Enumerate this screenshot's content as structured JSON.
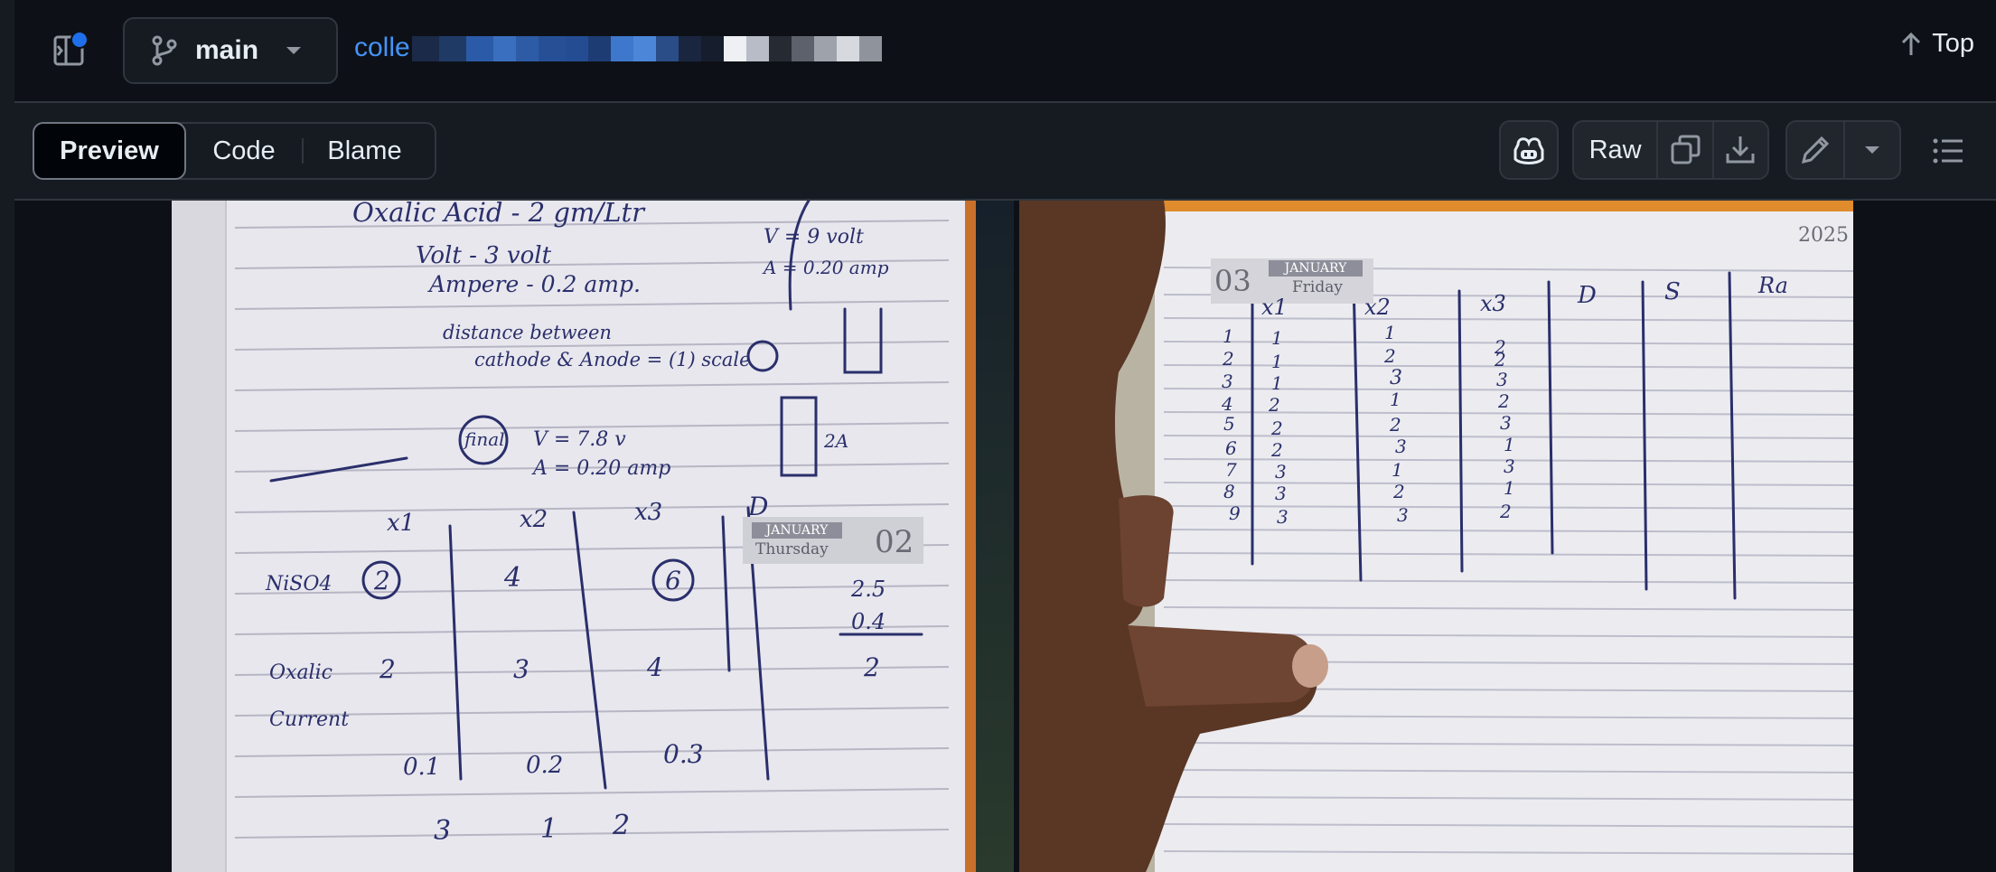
{
  "header": {
    "branch_label": "main",
    "path_prefix": "colle",
    "top_label": "Top"
  },
  "toolbar": {
    "tabs": [
      {
        "label": "Preview",
        "active": true
      },
      {
        "label": "Code",
        "active": false
      },
      {
        "label": "Blame",
        "active": false
      }
    ],
    "raw_label": "Raw",
    "icons": [
      "copilot-icon",
      "copy-icon",
      "download-icon",
      "pencil-icon",
      "chevron-down-icon",
      "list-icon"
    ]
  },
  "photo_left": {
    "lines": [
      "Oxalic Acid - 2 gm/Ltr",
      "Volt - 3 volt",
      "Ampere - 0.2 amp.",
      "V = 9 volt",
      "A = 0.20 amp",
      "distance between",
      "cathode & Anode = (1) scale",
      "V = 7.8 v",
      "A = 0.20 amp",
      "final",
      "2A"
    ],
    "stamp": {
      "month": "JANUARY",
      "day_name": "Thursday",
      "day": "02"
    },
    "table_headers": [
      "x1",
      "x2",
      "x3",
      "D"
    ],
    "rows": [
      {
        "label": "NiSO4",
        "values": [
          "2",
          "4",
          "6"
        ]
      },
      {
        "label": "Oxalic",
        "values": [
          "2",
          "3",
          "4"
        ]
      },
      {
        "label": "Current",
        "values": [
          "0.1",
          "0.2",
          "0.3"
        ]
      }
    ],
    "side_calc": [
      "2.5",
      "0.4",
      "2"
    ],
    "bottom_row": [
      "3",
      "1",
      "2"
    ]
  },
  "photo_right": {
    "year": "2025",
    "stamp": {
      "day": "03",
      "month": "JANUARY",
      "day_name": "Friday"
    },
    "headers": [
      "x1",
      "x2",
      "x3",
      "D",
      "S",
      "Ra"
    ],
    "row_numbers": [
      "1",
      "2",
      "3",
      "4",
      "5",
      "6",
      "7",
      "8",
      "9"
    ],
    "x1": [
      "1",
      "1",
      "1",
      "2",
      "2",
      "2",
      "3",
      "3",
      "3"
    ],
    "x2": [
      "1",
      "2",
      "3",
      "1",
      "2",
      "3",
      "1",
      "2",
      "3"
    ],
    "x3": [
      "2",
      "2",
      "3",
      "2",
      "3",
      "1",
      "3",
      "1",
      "2"
    ]
  }
}
